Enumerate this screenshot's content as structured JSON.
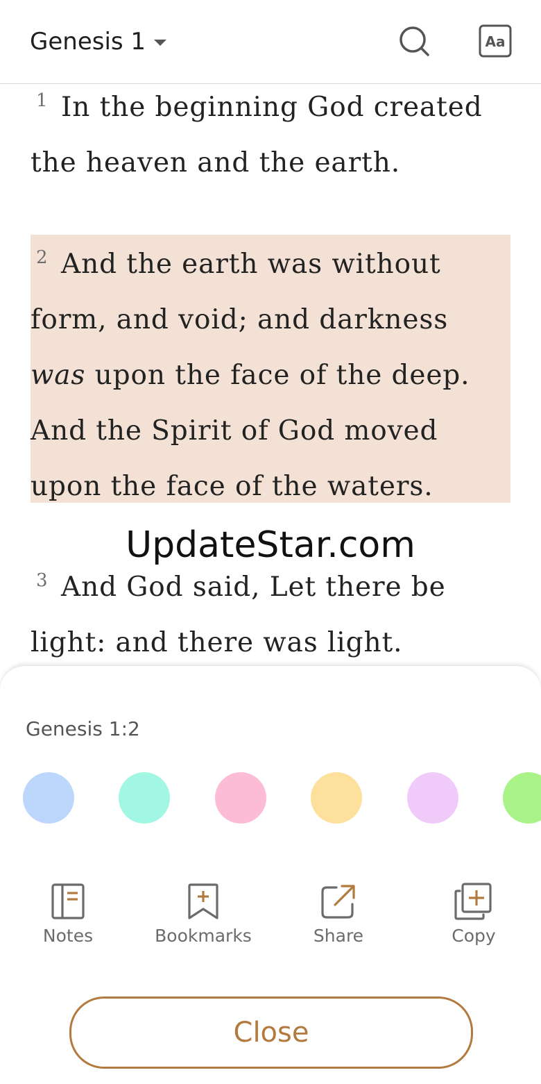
{
  "header": {
    "book_title": "Genesis 1",
    "search_icon": "search-icon",
    "font_settings_label": "Aa"
  },
  "verses": [
    {
      "number": "1",
      "text": "In the beginning God created the heaven and the earth.",
      "highlighted": false
    },
    {
      "number": "2",
      "text_before_italic": "And the earth was without form, and void; and darkness ",
      "italic": "was",
      "text_after_italic": " upon the face of the deep. And the Spirit of God moved upon the face of the waters.",
      "highlighted": true,
      "highlight_color": "#f2e1d4"
    },
    {
      "number": "3",
      "text": "And God said, Let there be light: and there was light.",
      "highlighted": false
    }
  ],
  "watermark": "UpdateStar.com",
  "sheet": {
    "reference": "Genesis 1:2",
    "highlight_colors": [
      "#bcd7fb",
      "#a1f7e3",
      "#fdbcd5",
      "#fde09b",
      "#f0cbf9",
      "#aaf389"
    ],
    "actions": [
      {
        "label": "Notes",
        "icon": "notes-icon"
      },
      {
        "label": "Bookmarks",
        "icon": "bookmark-add-icon"
      },
      {
        "label": "Share",
        "icon": "share-icon"
      },
      {
        "label": "Copy",
        "icon": "copy-icon"
      }
    ],
    "close_label": "Close",
    "accent_color": "#b27a3e",
    "icon_color": "#6b6b6b"
  }
}
